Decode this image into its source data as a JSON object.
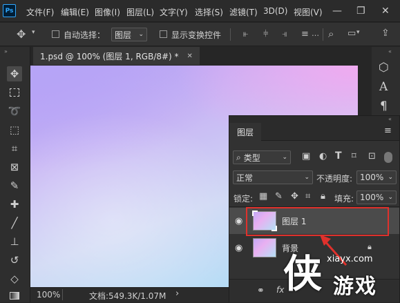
{
  "app": {
    "logo_text": "Ps"
  },
  "menu": [
    "文件(F)",
    "编辑(E)",
    "图像(I)",
    "图层(L)",
    "文字(Y)",
    "选择(S)",
    "滤镜(T)",
    "3D(D)",
    "视图(V)"
  ],
  "window_controls": {
    "minimize": "—",
    "restore": "❐",
    "close": "✕"
  },
  "options": {
    "auto_select_label": "自动选择：",
    "auto_select_value": "图层",
    "show_transform_label": "显示变换控件"
  },
  "document": {
    "tab_title": "1.psd @ 100% (图层 1, RGB/8#) *",
    "tab_close": "✕"
  },
  "status": {
    "zoom": "100%",
    "doc_info": "文档:549.3K/1.07M"
  },
  "right_tools": {
    "type_label": "A",
    "paragraph_label": "¶"
  },
  "layers_panel": {
    "tab_label": "图层",
    "filter_kind": "类型",
    "blend_mode": "正常",
    "opacity_label": "不透明度:",
    "opacity_value": "100%",
    "lock_label": "锁定:",
    "fill_label": "填充:",
    "fill_value": "100%",
    "layers": [
      {
        "name": "图层 1",
        "selected": true
      },
      {
        "name": "背景",
        "selected": false,
        "locked": true
      }
    ]
  },
  "watermark": {
    "url": "xiayx.com",
    "big_char": "侠",
    "text": "游戏"
  },
  "colors": {
    "highlight": "#e0312c",
    "ps_blue": "#31a8ff"
  }
}
